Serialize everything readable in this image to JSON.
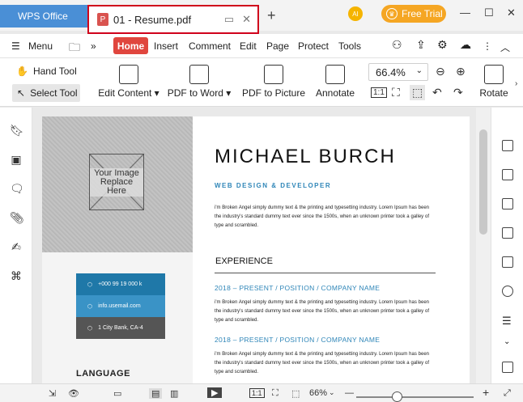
{
  "titlebar": {
    "app_tab": "WPS Office",
    "doc_tab": "01 - Resume.pdf",
    "avatar": "AI",
    "free_trial": "Free Trial"
  },
  "menu": {
    "menu_label": "Menu",
    "items": [
      "Home",
      "Insert",
      "Comment",
      "Edit",
      "Page",
      "Protect",
      "Tools"
    ]
  },
  "ribbon": {
    "hand_tool": "Hand Tool",
    "select_tool": "Select Tool",
    "edit_content": "Edit Content",
    "pdf_to_word": "PDF to Word",
    "pdf_to_picture": "PDF to Picture",
    "annotate": "Annotate",
    "zoom": "66.4%",
    "rotate": "Rotate"
  },
  "resume": {
    "photo_placeholder": "Your Image Replace Here",
    "name": "MICHAEL BURCH",
    "role": "WEB DESIGN & DEVELOPER",
    "intro": "i'm Broken Angel simply dummy text & the printing and typesetting industry. Lorem Ipsum has been the industry's standard dummy text ever since the 1500s, when an unknown printer took a galley of type and scrambled.",
    "experience_title": "EXPERIENCE",
    "job1": "2018 – PRESENT / POSITION / COMPANY NAME",
    "job1_text": "i'm Broken Angel simply dummy text & the printing and typesetting industry. Lorem Ipsum has been the industry's standard dummy text ever since the 1500s, when an unknown printer took a galley of type and scrambled.",
    "job2": "2018 – PRESENT / POSITION / COMPANY NAME",
    "job2_text": "i'm Broken Angel simply dummy text & the printing and typesetting industry. Lorem Ipsum has been the industry's standard dummy text ever since the 1500s, when an unknown printer took a galley of type and scrambled.",
    "phone": "+000 99 19 000 k",
    "email": "info.usemail.com",
    "address": "1 City Bank, CA-4",
    "language_title": "LANGUAGE"
  },
  "status": {
    "zoom": "66%"
  },
  "colors": {
    "accent": "#e0463e",
    "wps_blue": "#4a8fd6",
    "contact1": "#1f78a8",
    "contact2": "#3a93c6",
    "contact3": "#555555"
  }
}
